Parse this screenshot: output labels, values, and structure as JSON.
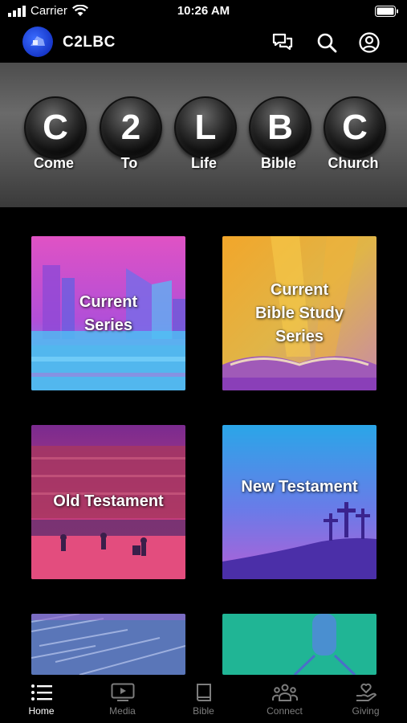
{
  "status_bar": {
    "carrier": "Carrier",
    "time": "10:26 AM"
  },
  "header": {
    "title": "C2LBC",
    "icons": [
      "chat-icon",
      "search-icon",
      "profile-icon"
    ]
  },
  "banner": {
    "letters": [
      {
        "letter": "C",
        "word": "Come"
      },
      {
        "letter": "2",
        "word": "To"
      },
      {
        "letter": "L",
        "word": "Life"
      },
      {
        "letter": "B",
        "word": "Bible"
      },
      {
        "letter": "C",
        "word": "Church"
      }
    ]
  },
  "tiles": [
    {
      "label_lines": [
        "Current",
        "Series"
      ]
    },
    {
      "label_lines": [
        "Current",
        "Bible Study",
        "Series"
      ]
    },
    {
      "label_lines": [
        "Old Testament"
      ]
    },
    {
      "label_lines": [
        "New Testament"
      ]
    },
    {
      "label_lines": []
    },
    {
      "label_lines": []
    }
  ],
  "tabbar": {
    "active": "Home",
    "items": [
      {
        "label": "Home",
        "icon": "list-icon"
      },
      {
        "label": "Media",
        "icon": "tv-play-icon"
      },
      {
        "label": "Bible",
        "icon": "book-icon"
      },
      {
        "label": "Connect",
        "icon": "group-icon"
      },
      {
        "label": "Giving",
        "icon": "hand-heart-icon"
      }
    ]
  },
  "colors": {
    "active_tab": "#ffffff",
    "inactive_tab": "#7d7d7d",
    "logo": "#1f44d8"
  }
}
